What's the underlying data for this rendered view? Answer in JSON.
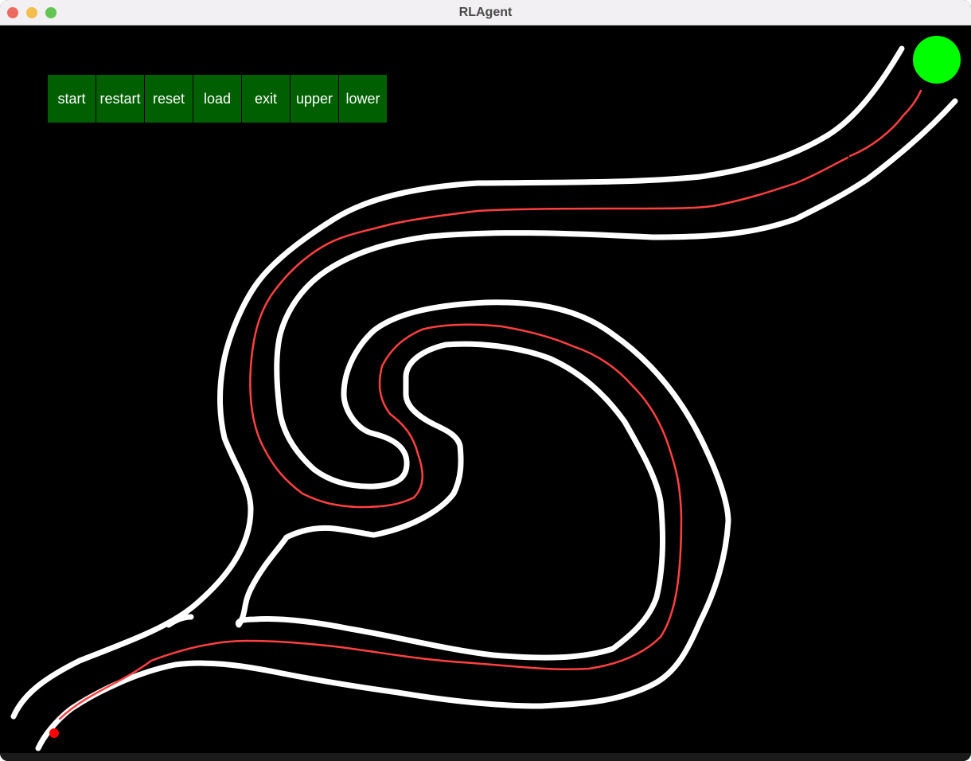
{
  "window": {
    "title": "RLAgent"
  },
  "toolbar": {
    "buttons": [
      "start",
      "restart",
      "reset",
      "load",
      "exit",
      "upper",
      "lower"
    ],
    "button_color": "#005f00",
    "text_color": "#ffffff"
  },
  "scene": {
    "background_color": "#000000",
    "track_color": "#ffffff",
    "path_color": "#ff4040",
    "goal_color": "#00ff00",
    "agent_color": "#ff0000"
  }
}
